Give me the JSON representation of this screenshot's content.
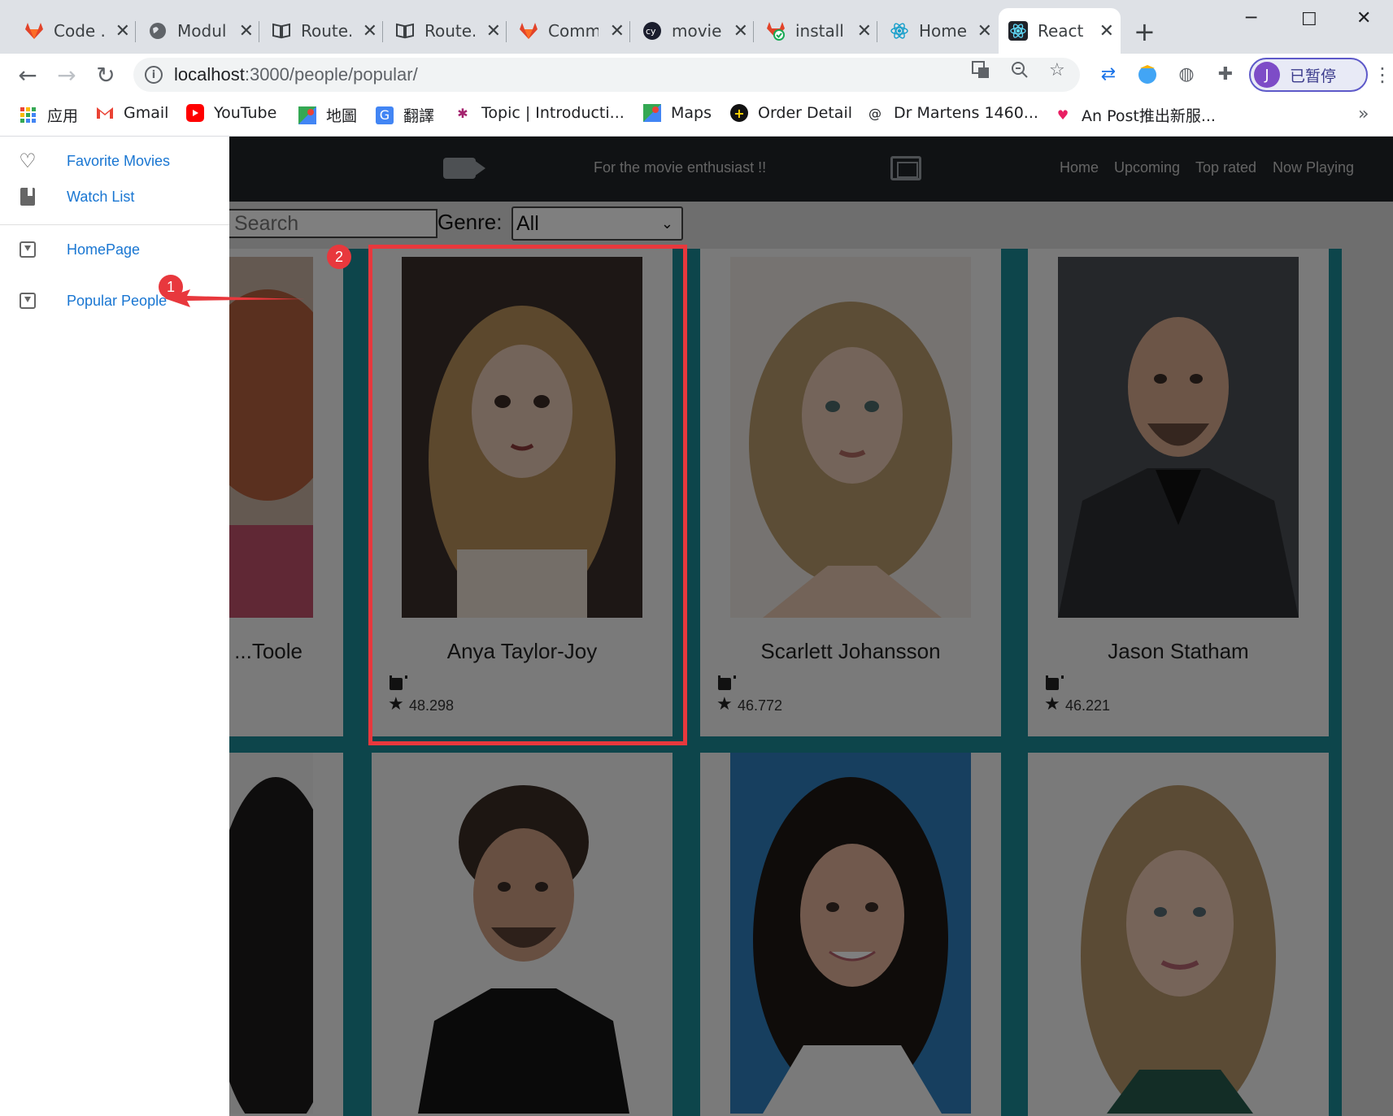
{
  "browser": {
    "tabs": [
      {
        "label": "Code ...",
        "icon": "gitlab-icon"
      },
      {
        "label": "Modul...",
        "icon": "globe-icon"
      },
      {
        "label": "Route...",
        "icon": "book-icon"
      },
      {
        "label": "Route...",
        "icon": "book-icon"
      },
      {
        "label": "Comm...",
        "icon": "gitlab-icon"
      },
      {
        "label": "movie...",
        "icon": "cypress-icon"
      },
      {
        "label": "install...",
        "icon": "gitlab-check-icon"
      },
      {
        "label": "Home",
        "icon": "react-icon"
      },
      {
        "label": "React ...",
        "icon": "react-icon",
        "active": true
      }
    ],
    "url_host": "localhost",
    "url_path": ":3000/people/popular/",
    "profile_initial": "J",
    "profile_label": "已暂停",
    "bookmarks": [
      {
        "label": "应用",
        "icon": "apps-grid-icon"
      },
      {
        "label": "Gmail",
        "icon": "gmail-icon"
      },
      {
        "label": "YouTube",
        "icon": "youtube-icon"
      },
      {
        "label": "地圖",
        "icon": "maps-icon"
      },
      {
        "label": "翻譯",
        "icon": "translate-icon"
      },
      {
        "label": "Topic | Introducti...",
        "icon": "slack-icon"
      },
      {
        "label": "Maps",
        "icon": "maps-icon"
      },
      {
        "label": "Order Detail",
        "icon": "plus-circle-icon"
      },
      {
        "label": "Dr Martens 1460...",
        "icon": "at-icon"
      },
      {
        "label": "An Post推出新服...",
        "icon": "heart-icon"
      }
    ]
  },
  "app": {
    "tagline": "For the movie enthusiast !!",
    "nav": [
      "Home",
      "Upcoming",
      "Top rated",
      "Now Playing"
    ],
    "search_placeholder": "Search",
    "genre_label": "Genre:",
    "genre_value": "All"
  },
  "drawer": {
    "items": [
      {
        "label": "Favorite Movies",
        "icon": "heart-outline-icon"
      },
      {
        "label": "Watch List",
        "icon": "bookmark-icon"
      },
      {
        "label": "HomePage",
        "icon": "inbox-icon"
      },
      {
        "label": "Popular People",
        "icon": "inbox-icon"
      }
    ]
  },
  "people": [
    {
      "name": "...Toole",
      "rating": ""
    },
    {
      "name": "Anya Taylor-Joy",
      "rating": "48.298"
    },
    {
      "name": "Scarlett Johansson",
      "rating": "46.772"
    },
    {
      "name": "Jason Statham",
      "rating": "46.221"
    }
  ],
  "annotations": {
    "badge1": "1",
    "badge2": "2"
  },
  "colors": {
    "accent": "#1976d2",
    "annotation": "#e8383d",
    "grid": "#1a8a96",
    "appbar": "#212529"
  }
}
